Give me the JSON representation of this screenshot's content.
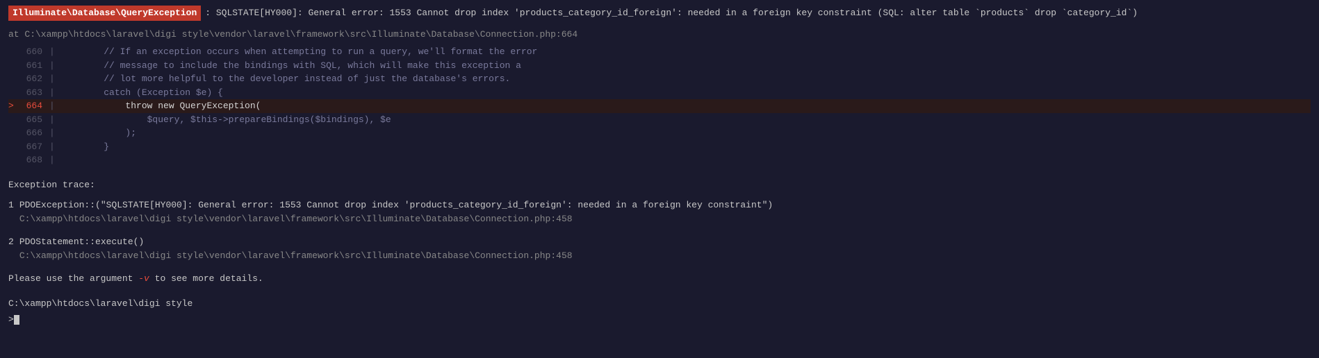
{
  "terminal": {
    "background": "#1a1a2e",
    "exception": {
      "class": "Illuminate\\Database\\QueryException",
      "message": ": SQLSTATE[HY000]: General error: 1553 Cannot drop index 'products_category_id_foreign': needed in a foreign key constraint (SQL: alter table `products` drop `category_id`)"
    },
    "at_line": "at C:\\xampp\\htdocs\\laravel\\digi style\\vendor\\laravel\\framework\\src\\Illuminate\\Database\\Connection.php:664",
    "code_lines": [
      {
        "num": "660",
        "active": false,
        "content": "        // If an exception occurs when attempting to run a query, we'll format the error"
      },
      {
        "num": "661",
        "active": false,
        "content": "        // message to include the bindings with SQL, which will make this exception a"
      },
      {
        "num": "662",
        "active": false,
        "content": "        // lot more helpful to the developer instead of just the database's errors."
      },
      {
        "num": "663",
        "active": false,
        "content": "        catch (Exception $e) {"
      },
      {
        "num": "664",
        "active": true,
        "content": "            throw new QueryException("
      },
      {
        "num": "665",
        "active": false,
        "content": "                $query, $this->prepareBindings($bindings), $e"
      },
      {
        "num": "666",
        "active": false,
        "content": "            );"
      },
      {
        "num": "667",
        "active": false,
        "content": "        }"
      },
      {
        "num": "668",
        "active": false,
        "content": ""
      }
    ],
    "exception_trace_label": "Exception trace:",
    "trace_items": [
      {
        "number": "1",
        "exception_line": "PDOException::(\"SQLSTATE[HY000]: General error: 1553 Cannot drop index 'products_category_id_foreign': needed in a foreign key constraint\")",
        "path": "C:\\xampp\\htdocs\\laravel\\digi style\\vendor\\laravel\\framework\\src\\Illuminate\\Database\\Connection.php:458"
      },
      {
        "number": "2",
        "exception_line": "PDOStatement::execute()",
        "path": "C:\\xampp\\htdocs\\laravel\\digi style\\vendor\\laravel\\framework\\src\\Illuminate\\Database\\Connection.php:458"
      }
    ],
    "please_use": "Please use the argument",
    "flag": "-v",
    "please_use_suffix": "to see more details.",
    "prompt_path": "C:\\xampp\\htdocs\\laravel\\digi style",
    "prompt_symbol": ">"
  }
}
